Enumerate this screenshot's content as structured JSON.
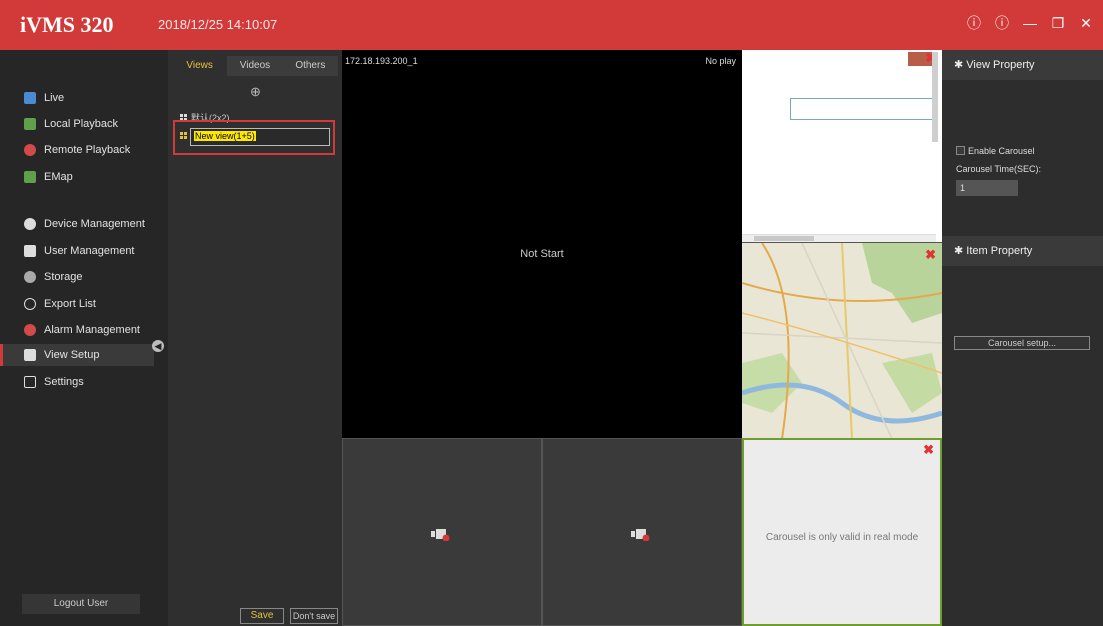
{
  "app": {
    "title": "iVMS 320",
    "datetime": "2018/12/25 14:10:07"
  },
  "window_controls": [
    "info-icon",
    "help-icon",
    "minimize-icon",
    "restore-icon",
    "close-icon"
  ],
  "sidebar": {
    "items": [
      {
        "label": "Live",
        "icon": "live-icon",
        "color": "#4a8ad4"
      },
      {
        "label": "Local Playback",
        "icon": "local-playback-icon",
        "color": "#5fa04a"
      },
      {
        "label": "Remote Playback",
        "icon": "remote-playback-icon",
        "color": "#d24a4a"
      },
      {
        "label": "EMap",
        "icon": "emap-icon",
        "color": "#5fa04a"
      },
      {
        "label": "Device Management",
        "icon": "device-management-icon",
        "color": "#dddddd"
      },
      {
        "label": "User Management",
        "icon": "user-management-icon",
        "color": "#dddddd"
      },
      {
        "label": "Storage",
        "icon": "storage-icon",
        "color": "#dddddd"
      },
      {
        "label": "Export List",
        "icon": "export-list-icon",
        "color": "#dddddd"
      },
      {
        "label": "Alarm Management",
        "icon": "alarm-management-icon",
        "color": "#d24a4a"
      },
      {
        "label": "View Setup",
        "icon": "view-setup-icon",
        "color": "#dddddd",
        "active": true
      },
      {
        "label": "Settings",
        "icon": "settings-icon",
        "color": "#dddddd"
      }
    ],
    "logout_label": "Logout User"
  },
  "viewlist": {
    "tabs": [
      "Views",
      "Videos",
      "Others"
    ],
    "active_tab": "Views",
    "views": [
      {
        "label": "默认(2x2)"
      },
      {
        "label": "New view(1+5)",
        "editing": true
      }
    ],
    "save_label": "Save",
    "dont_save_label": "Don't save"
  },
  "grid": {
    "main_cell": {
      "ip": "172.18.193.200_1",
      "status": "No play",
      "center_text": "Not Start"
    },
    "carousel_message": "Carousel is only valid in real mode"
  },
  "properties": {
    "view_property_title": "View Property",
    "enable_carousel_label": "Enable Carousel",
    "carousel_time_label": "Carousel Time(SEC):",
    "carousel_time_value": "1",
    "item_property_title": "Item Property",
    "carousel_setup_label": "Carousel setup..."
  },
  "colors": {
    "accent": "#d23a3a",
    "highlight_text": "#e6c13a",
    "carousel_border": "#6d9f2c"
  }
}
